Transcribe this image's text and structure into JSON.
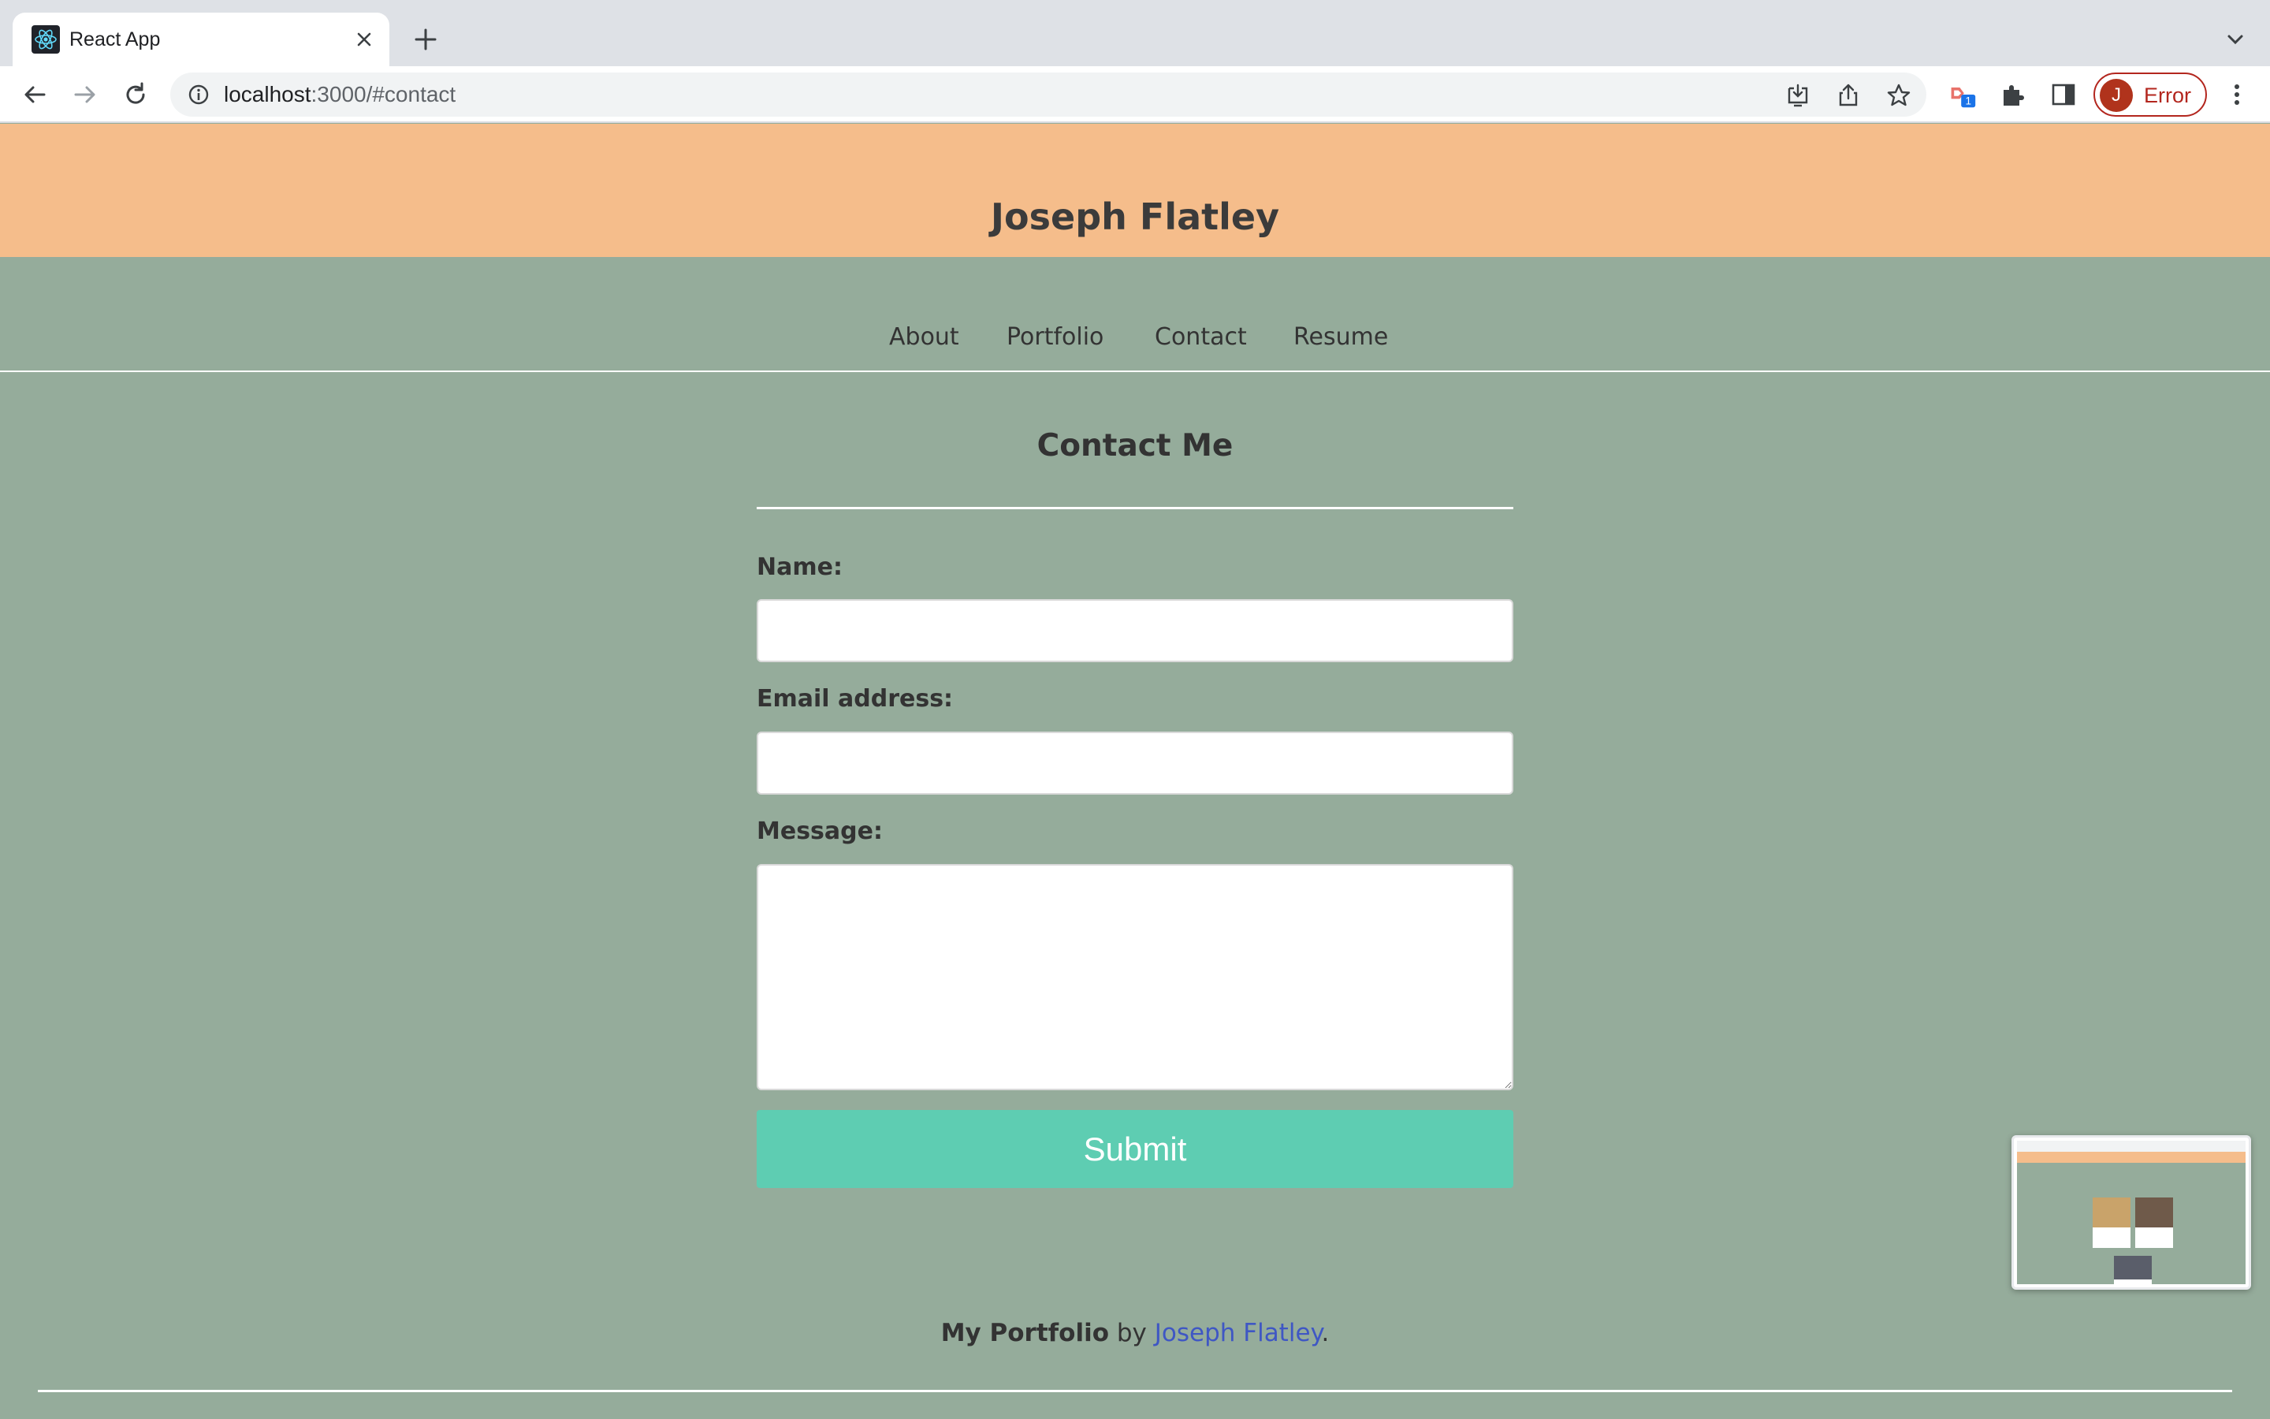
{
  "browser": {
    "tab_title": "React App",
    "url_host": "localhost",
    "url_rest": ":3000/#contact",
    "profile_initial": "J",
    "profile_status": "Error",
    "extension_badge": "1"
  },
  "site": {
    "title": "Joseph Flatley",
    "nav": [
      "About",
      "Portfolio",
      "Contact",
      "Resume"
    ]
  },
  "contact": {
    "heading": "Contact Me",
    "name_label": "Name:",
    "name_value": "",
    "email_label": "Email address:",
    "email_value": "",
    "message_label": "Message:",
    "message_value": "",
    "submit_label": "Submit"
  },
  "footer": {
    "brand": "My Portfolio",
    "by": " by ",
    "author": "Joseph Flatley",
    "end": "."
  },
  "colors": {
    "header_bg": "#f5bd8b",
    "page_bg": "#95ac9b",
    "submit_bg": "#5ecdb2",
    "link": "#3f57c4"
  }
}
